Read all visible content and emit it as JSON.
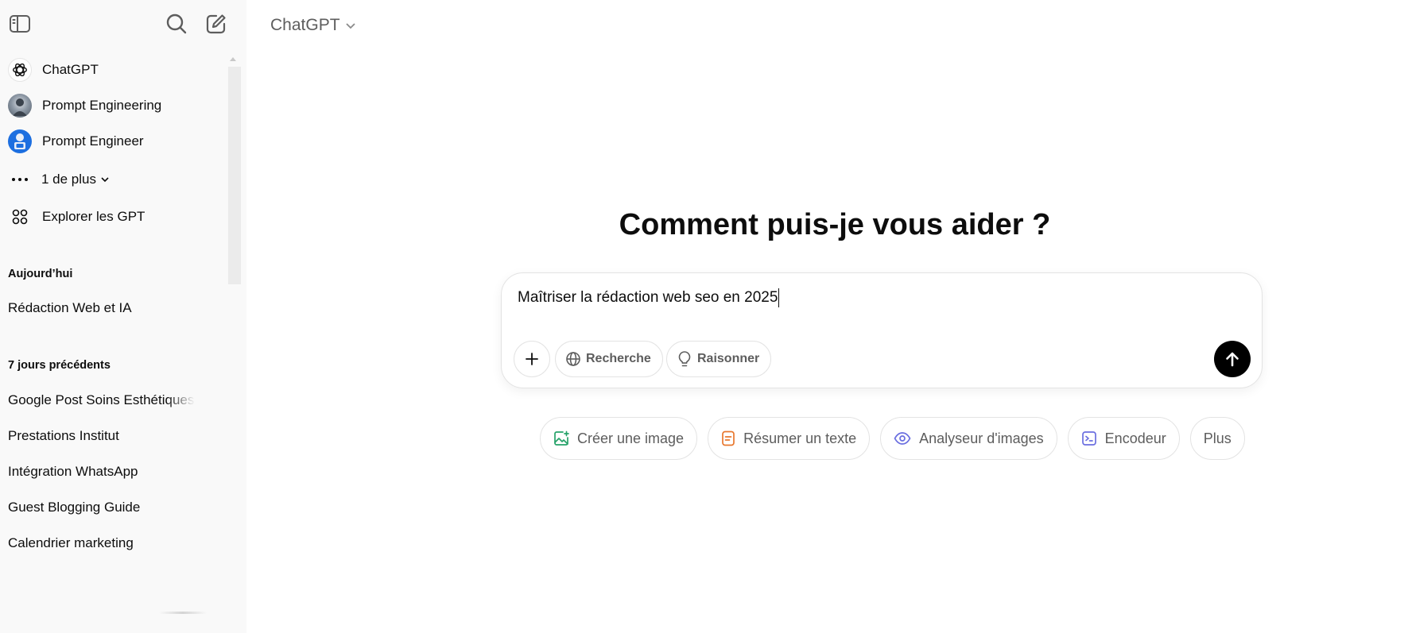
{
  "sidebar": {
    "gpts": [
      {
        "label": "ChatGPT",
        "icon": "openai-logo-icon"
      },
      {
        "label": "Prompt Engineering",
        "icon": "avatar"
      },
      {
        "label": "Prompt Engineer",
        "icon": "avatar"
      }
    ],
    "more_label": "1 de plus",
    "explore_label": "Explorer les GPT",
    "sections": [
      {
        "title": "Aujourd’hui",
        "items": [
          "Rédaction Web et IA"
        ]
      },
      {
        "title": "7 jours précédents",
        "items": [
          "Google Post Soins Esthétiques",
          "Prestations Institut",
          "Intégration WhatsApp",
          "Guest Blogging Guide",
          "Calendrier marketing"
        ]
      }
    ]
  },
  "header": {
    "model_name": "ChatGPT"
  },
  "main": {
    "headline": "Comment puis-je vous aider ?",
    "composer": {
      "value": "Maîtriser la rédaction web seo en 2025",
      "tools": [
        {
          "label": "Recherche",
          "icon": "globe-icon"
        },
        {
          "label": "Raisonner",
          "icon": "lightbulb-icon"
        }
      ]
    },
    "suggestions": [
      {
        "label": "Créer une image",
        "icon": "image-icon",
        "color": "#26a269"
      },
      {
        "label": "Résumer un texte",
        "icon": "document-icon",
        "color": "#e8772e"
      },
      {
        "label": "Analyseur d'images",
        "icon": "eye-icon",
        "color": "#6b6fe0"
      },
      {
        "label": "Encodeur",
        "icon": "terminal-icon",
        "color": "#6b6fe0"
      },
      {
        "label": "Plus",
        "icon": ""
      }
    ]
  },
  "colors": {
    "sidebar_bg": "#f9f9f9",
    "send_button": "#000000",
    "muted_text": "#5d5d5d"
  }
}
